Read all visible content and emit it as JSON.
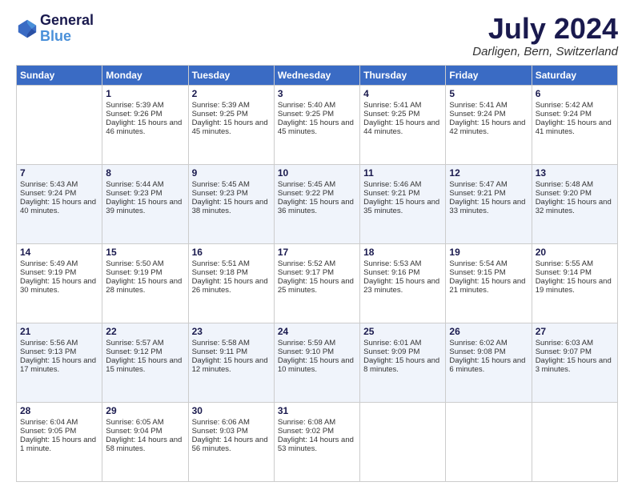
{
  "header": {
    "logo_line1": "General",
    "logo_line2": "Blue",
    "month": "July 2024",
    "location": "Darligen, Bern, Switzerland"
  },
  "days_of_week": [
    "Sunday",
    "Monday",
    "Tuesday",
    "Wednesday",
    "Thursday",
    "Friday",
    "Saturday"
  ],
  "weeks": [
    [
      {
        "day": "",
        "sunrise": "",
        "sunset": "",
        "daylight": ""
      },
      {
        "day": "1",
        "sunrise": "Sunrise: 5:39 AM",
        "sunset": "Sunset: 9:26 PM",
        "daylight": "Daylight: 15 hours and 46 minutes."
      },
      {
        "day": "2",
        "sunrise": "Sunrise: 5:39 AM",
        "sunset": "Sunset: 9:25 PM",
        "daylight": "Daylight: 15 hours and 45 minutes."
      },
      {
        "day": "3",
        "sunrise": "Sunrise: 5:40 AM",
        "sunset": "Sunset: 9:25 PM",
        "daylight": "Daylight: 15 hours and 45 minutes."
      },
      {
        "day": "4",
        "sunrise": "Sunrise: 5:41 AM",
        "sunset": "Sunset: 9:25 PM",
        "daylight": "Daylight: 15 hours and 44 minutes."
      },
      {
        "day": "5",
        "sunrise": "Sunrise: 5:41 AM",
        "sunset": "Sunset: 9:24 PM",
        "daylight": "Daylight: 15 hours and 42 minutes."
      },
      {
        "day": "6",
        "sunrise": "Sunrise: 5:42 AM",
        "sunset": "Sunset: 9:24 PM",
        "daylight": "Daylight: 15 hours and 41 minutes."
      }
    ],
    [
      {
        "day": "7",
        "sunrise": "Sunrise: 5:43 AM",
        "sunset": "Sunset: 9:24 PM",
        "daylight": "Daylight: 15 hours and 40 minutes."
      },
      {
        "day": "8",
        "sunrise": "Sunrise: 5:44 AM",
        "sunset": "Sunset: 9:23 PM",
        "daylight": "Daylight: 15 hours and 39 minutes."
      },
      {
        "day": "9",
        "sunrise": "Sunrise: 5:45 AM",
        "sunset": "Sunset: 9:23 PM",
        "daylight": "Daylight: 15 hours and 38 minutes."
      },
      {
        "day": "10",
        "sunrise": "Sunrise: 5:45 AM",
        "sunset": "Sunset: 9:22 PM",
        "daylight": "Daylight: 15 hours and 36 minutes."
      },
      {
        "day": "11",
        "sunrise": "Sunrise: 5:46 AM",
        "sunset": "Sunset: 9:21 PM",
        "daylight": "Daylight: 15 hours and 35 minutes."
      },
      {
        "day": "12",
        "sunrise": "Sunrise: 5:47 AM",
        "sunset": "Sunset: 9:21 PM",
        "daylight": "Daylight: 15 hours and 33 minutes."
      },
      {
        "day": "13",
        "sunrise": "Sunrise: 5:48 AM",
        "sunset": "Sunset: 9:20 PM",
        "daylight": "Daylight: 15 hours and 32 minutes."
      }
    ],
    [
      {
        "day": "14",
        "sunrise": "Sunrise: 5:49 AM",
        "sunset": "Sunset: 9:19 PM",
        "daylight": "Daylight: 15 hours and 30 minutes."
      },
      {
        "day": "15",
        "sunrise": "Sunrise: 5:50 AM",
        "sunset": "Sunset: 9:19 PM",
        "daylight": "Daylight: 15 hours and 28 minutes."
      },
      {
        "day": "16",
        "sunrise": "Sunrise: 5:51 AM",
        "sunset": "Sunset: 9:18 PM",
        "daylight": "Daylight: 15 hours and 26 minutes."
      },
      {
        "day": "17",
        "sunrise": "Sunrise: 5:52 AM",
        "sunset": "Sunset: 9:17 PM",
        "daylight": "Daylight: 15 hours and 25 minutes."
      },
      {
        "day": "18",
        "sunrise": "Sunrise: 5:53 AM",
        "sunset": "Sunset: 9:16 PM",
        "daylight": "Daylight: 15 hours and 23 minutes."
      },
      {
        "day": "19",
        "sunrise": "Sunrise: 5:54 AM",
        "sunset": "Sunset: 9:15 PM",
        "daylight": "Daylight: 15 hours and 21 minutes."
      },
      {
        "day": "20",
        "sunrise": "Sunrise: 5:55 AM",
        "sunset": "Sunset: 9:14 PM",
        "daylight": "Daylight: 15 hours and 19 minutes."
      }
    ],
    [
      {
        "day": "21",
        "sunrise": "Sunrise: 5:56 AM",
        "sunset": "Sunset: 9:13 PM",
        "daylight": "Daylight: 15 hours and 17 minutes."
      },
      {
        "day": "22",
        "sunrise": "Sunrise: 5:57 AM",
        "sunset": "Sunset: 9:12 PM",
        "daylight": "Daylight: 15 hours and 15 minutes."
      },
      {
        "day": "23",
        "sunrise": "Sunrise: 5:58 AM",
        "sunset": "Sunset: 9:11 PM",
        "daylight": "Daylight: 15 hours and 12 minutes."
      },
      {
        "day": "24",
        "sunrise": "Sunrise: 5:59 AM",
        "sunset": "Sunset: 9:10 PM",
        "daylight": "Daylight: 15 hours and 10 minutes."
      },
      {
        "day": "25",
        "sunrise": "Sunrise: 6:01 AM",
        "sunset": "Sunset: 9:09 PM",
        "daylight": "Daylight: 15 hours and 8 minutes."
      },
      {
        "day": "26",
        "sunrise": "Sunrise: 6:02 AM",
        "sunset": "Sunset: 9:08 PM",
        "daylight": "Daylight: 15 hours and 6 minutes."
      },
      {
        "day": "27",
        "sunrise": "Sunrise: 6:03 AM",
        "sunset": "Sunset: 9:07 PM",
        "daylight": "Daylight: 15 hours and 3 minutes."
      }
    ],
    [
      {
        "day": "28",
        "sunrise": "Sunrise: 6:04 AM",
        "sunset": "Sunset: 9:05 PM",
        "daylight": "Daylight: 15 hours and 1 minute."
      },
      {
        "day": "29",
        "sunrise": "Sunrise: 6:05 AM",
        "sunset": "Sunset: 9:04 PM",
        "daylight": "Daylight: 14 hours and 58 minutes."
      },
      {
        "day": "30",
        "sunrise": "Sunrise: 6:06 AM",
        "sunset": "Sunset: 9:03 PM",
        "daylight": "Daylight: 14 hours and 56 minutes."
      },
      {
        "day": "31",
        "sunrise": "Sunrise: 6:08 AM",
        "sunset": "Sunset: 9:02 PM",
        "daylight": "Daylight: 14 hours and 53 minutes."
      },
      {
        "day": "",
        "sunrise": "",
        "sunset": "",
        "daylight": ""
      },
      {
        "day": "",
        "sunrise": "",
        "sunset": "",
        "daylight": ""
      },
      {
        "day": "",
        "sunrise": "",
        "sunset": "",
        "daylight": ""
      }
    ]
  ]
}
